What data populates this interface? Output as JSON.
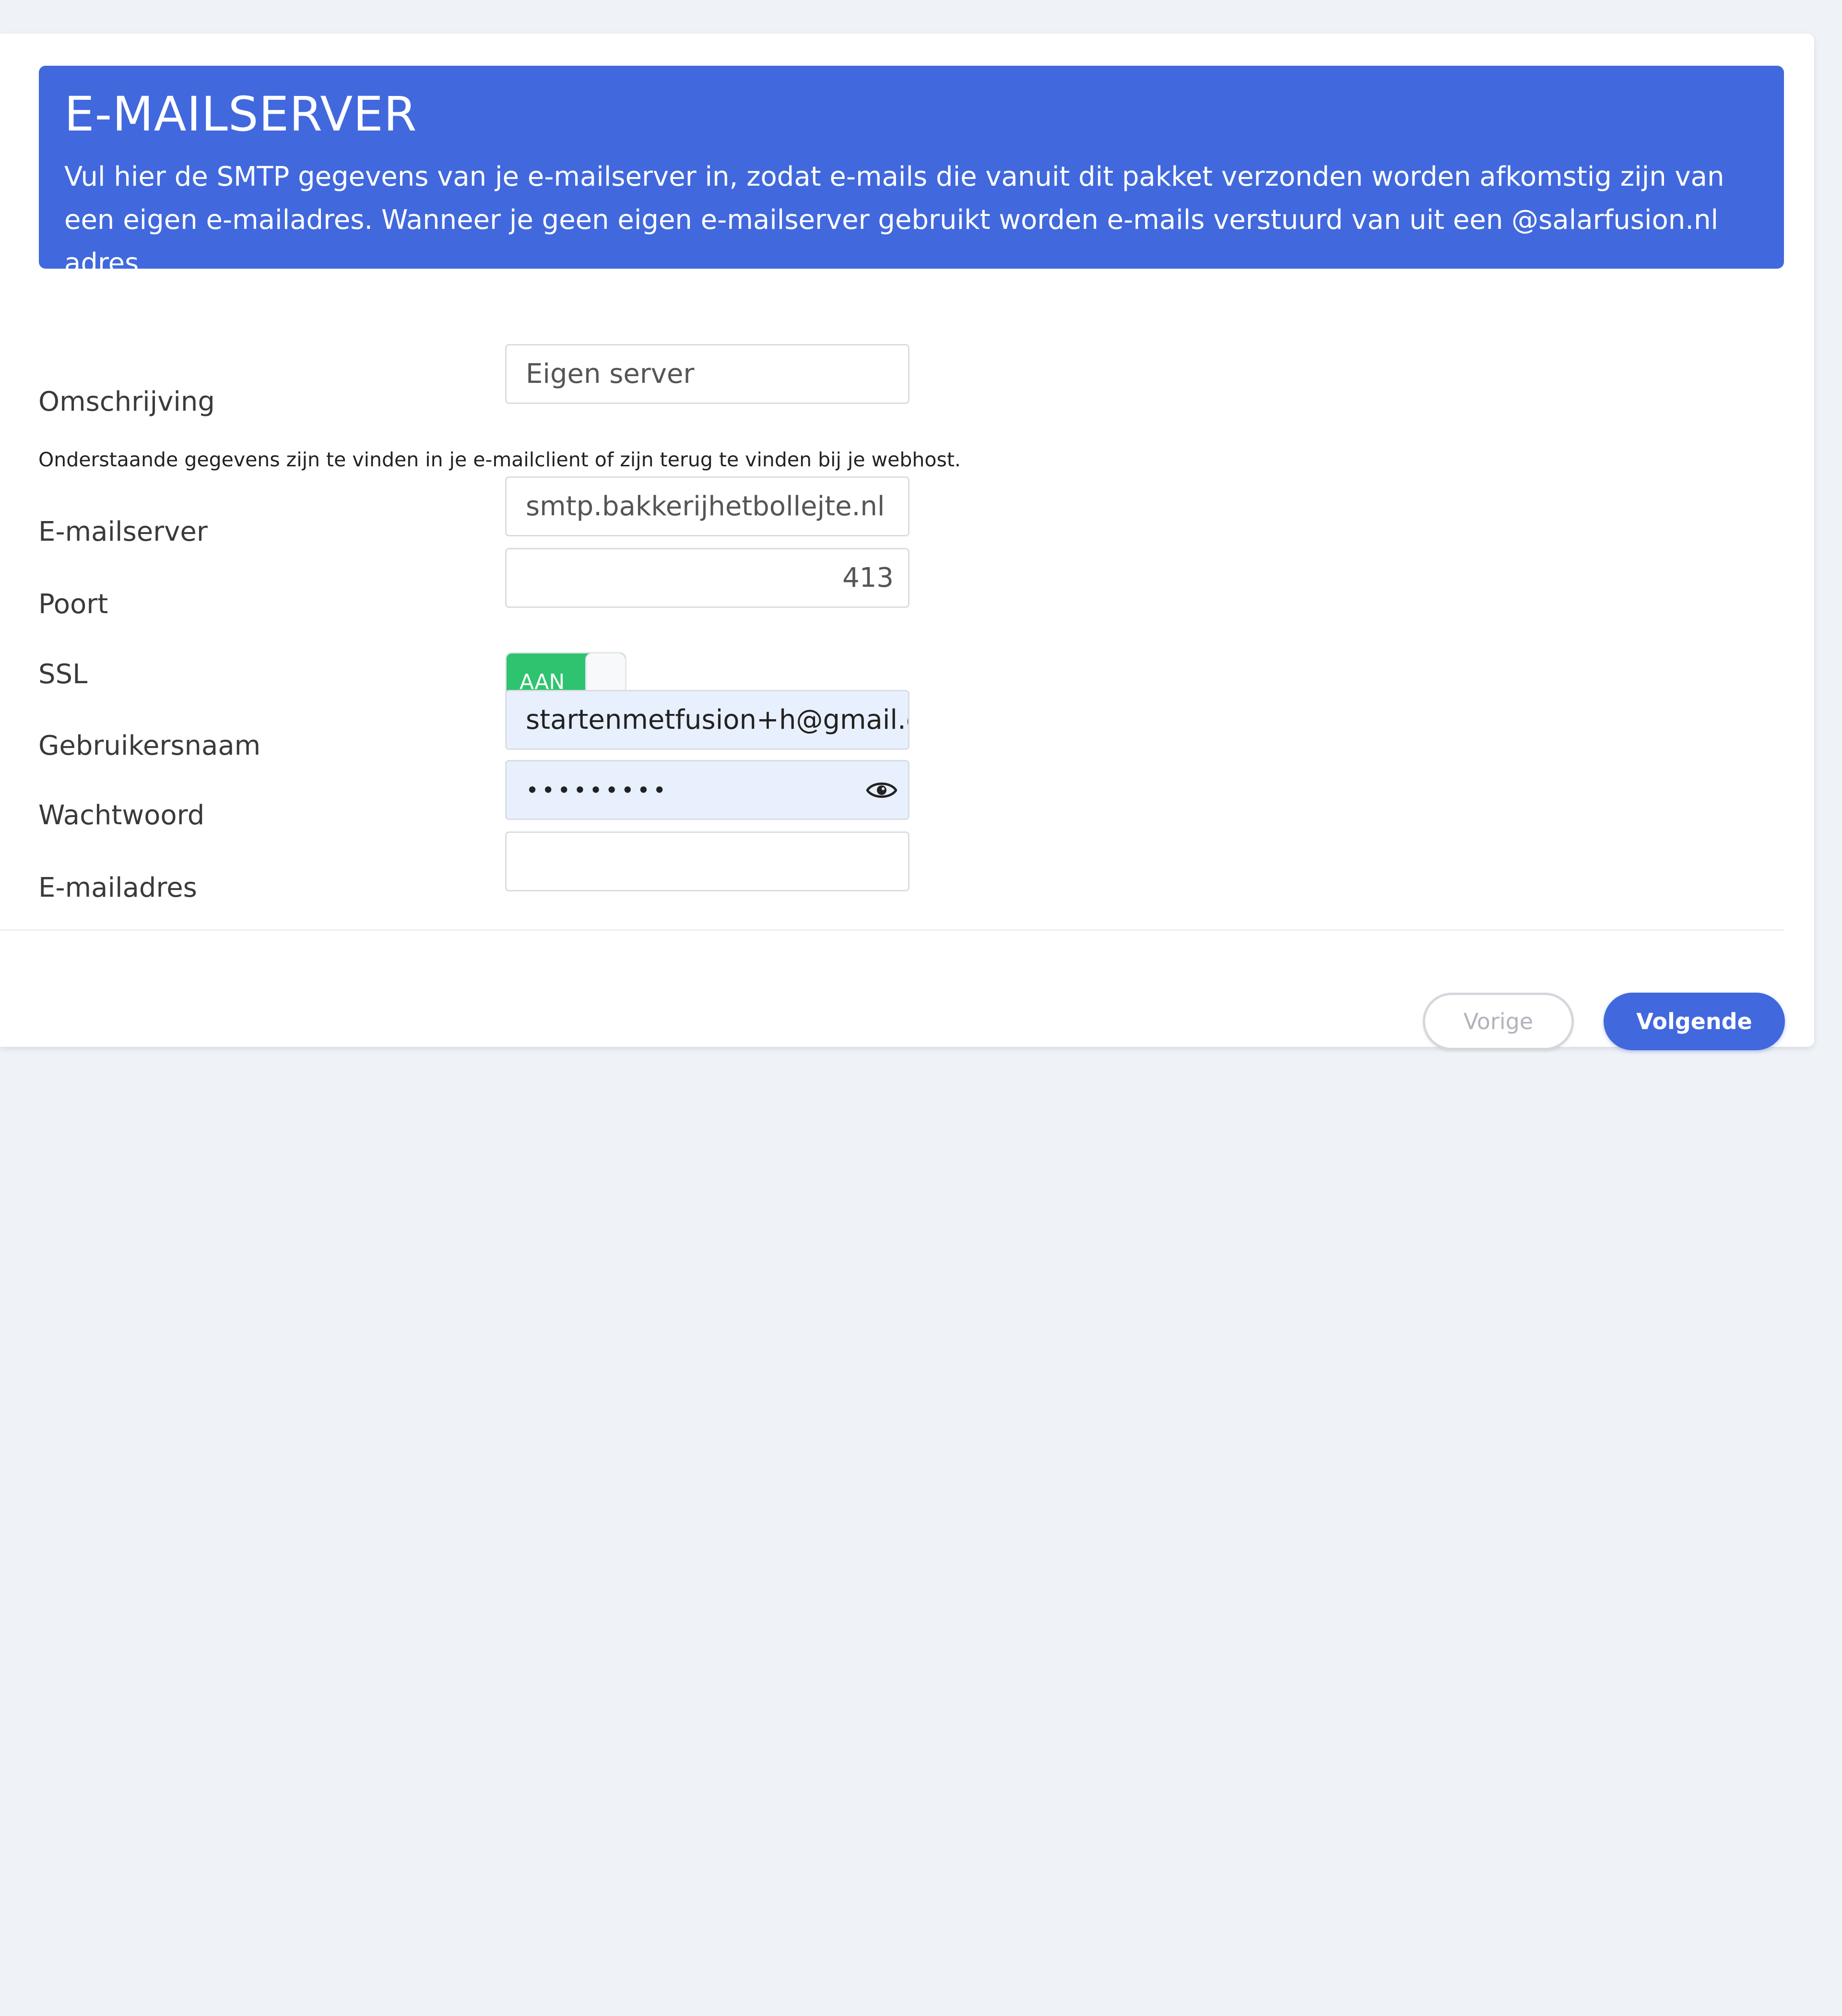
{
  "banner": {
    "title": "E-MAILSERVER",
    "description": "Vul hier de SMTP gegevens van je e-mailserver in, zodat e-mails die vanuit dit pakket verzonden worden afkomstig zijn van een eigen e-mailadres. Wanneer je geen eigen e-mailserver gebruikt worden e-mails verstuurd van uit een @salarfusion.nl adres."
  },
  "form": {
    "description": {
      "label": "Omschrijving",
      "value": "Eigen server"
    },
    "hint": "Onderstaande gegevens zijn te vinden in je e-mailclient of zijn terug te vinden bij je webhost.",
    "mailserver": {
      "label": "E-mailserver",
      "value": "smtp.bakkerijhetbollejte.nl"
    },
    "port": {
      "label": "Poort",
      "value": "413"
    },
    "ssl": {
      "label": "SSL",
      "toggle_text": "AAN",
      "on": true
    },
    "username": {
      "label": "Gebruikersnaam",
      "value": "startenmetfusion+h@gmail.cor"
    },
    "password": {
      "label": "Wachtwoord",
      "masked": "•••••••••",
      "icon": "eye-icon"
    },
    "email": {
      "label": "E-mailadres",
      "value": ""
    }
  },
  "footer": {
    "prev_label": "Vorige",
    "next_label": "Volgende"
  },
  "colors": {
    "accent": "#4169dd",
    "toggle_on": "#2ec46f",
    "autofill": "#e8f0fe",
    "background": "#eff2f7"
  }
}
